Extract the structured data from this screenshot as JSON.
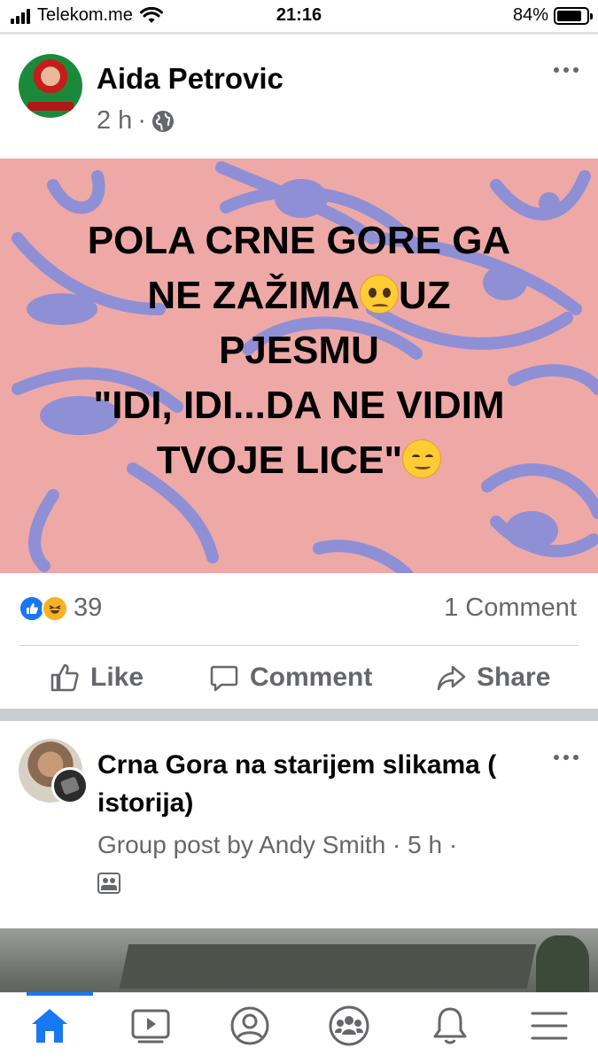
{
  "status_bar": {
    "carrier": "Telekom.me",
    "time": "21:16",
    "battery": "84%",
    "battery_level": 0.84,
    "icons": [
      "signal-icon",
      "wifi-icon",
      "battery-icon"
    ]
  },
  "post1": {
    "author": "Aida Petrovic",
    "time": "2 h",
    "separator": "·",
    "privacy_icon": "globe-icon",
    "image_text": {
      "line1": "POLA CRNE GORE  GA",
      "line2a": "NE ZAŽIMA",
      "line2b": "UZ",
      "line3": "PJESMU",
      "line4": "\"IDI, IDI...DA NE VIDIM",
      "line5": "TVOJE LICE\"",
      "emoji1": "pleading-face-emoji",
      "emoji2": "smiling-face-emoji"
    },
    "reaction_count": "39",
    "reaction_icons": [
      "like-icon",
      "haha-icon"
    ],
    "comments": "1 Comment",
    "actions": {
      "like": "Like",
      "comment": "Comment",
      "share": "Share"
    }
  },
  "post2": {
    "group_name": "Crna Gora na starijem slikama ( istorija)",
    "meta": "Group post by Andy Smith · 5 h ·",
    "group_icon": "group-icon"
  },
  "tab_bar": {
    "tabs": [
      "home-icon",
      "watch-icon",
      "profile-icon",
      "groups-icon",
      "notifications-icon",
      "menu-icon"
    ],
    "active": "home-icon"
  },
  "colors": {
    "accent": "#1877f2",
    "image_bg": "#eea9a6",
    "image_pattern": "#8f8fd6",
    "secondary_text": "#65676b"
  }
}
